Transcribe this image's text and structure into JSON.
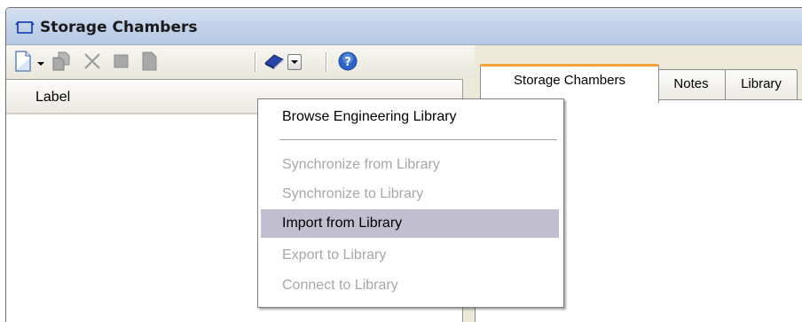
{
  "window": {
    "title": "Storage Chambers",
    "title_icon": "storage-chamber-icon"
  },
  "toolbar": {
    "buttons": [
      {
        "name": "new-document-icon",
        "has_dropdown": true
      },
      {
        "name": "copy-icon"
      },
      {
        "name": "delete-icon"
      },
      {
        "name": "block-icon"
      },
      {
        "name": "page-icon"
      },
      {
        "name": "library-book-icon",
        "has_dropdown": true
      },
      {
        "name": "help-icon"
      }
    ]
  },
  "list": {
    "column_header": "Label"
  },
  "tabs": [
    {
      "label": "Storage Chambers",
      "active": true
    },
    {
      "label": "Notes",
      "active": false
    },
    {
      "label": "Library",
      "active": false
    }
  ],
  "menu": {
    "items": [
      {
        "label": "Browse Engineering Library",
        "enabled": true,
        "highlighted": false
      },
      {
        "label": "Synchronize from Library",
        "enabled": false,
        "highlighted": false
      },
      {
        "label": "Synchronize to Library",
        "enabled": false,
        "highlighted": false
      },
      {
        "label": "Import from Library",
        "enabled": true,
        "highlighted": true
      },
      {
        "label": "Export to Library",
        "enabled": false,
        "highlighted": false
      },
      {
        "label": "Connect to Library",
        "enabled": false,
        "highlighted": false
      }
    ]
  },
  "colors": {
    "active_tab_accent": "#f3a43c",
    "menu_highlight": "#c1bfcf",
    "disabled_text": "#a7a6aa"
  }
}
